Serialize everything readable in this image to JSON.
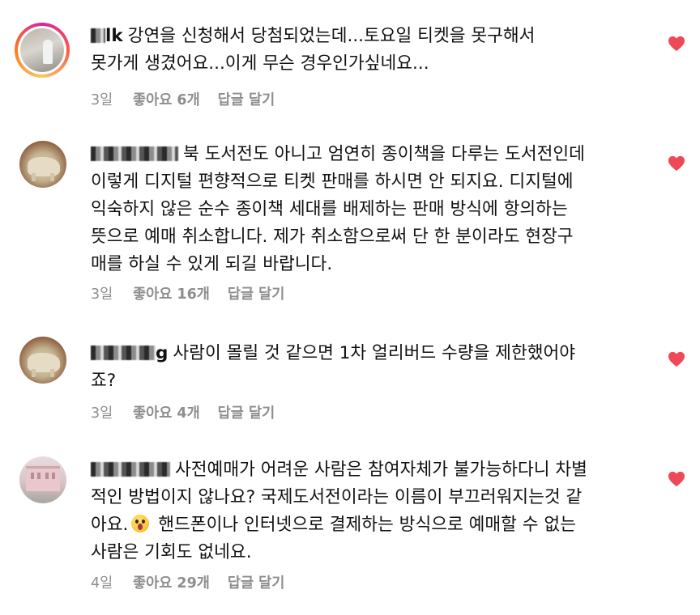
{
  "comments": [
    {
      "username": "lk",
      "text": "강연을 신청해서 당첨되었는데...토요일 티켓을 못구해서\n못가게 생겼어요...이게 무슨 경우인가싶네요...",
      "time": "3일",
      "likes": "좋아요 6개",
      "reply": "답글 달기",
      "avatar_icon": "profile-photo-story-ring",
      "liked": true
    },
    {
      "username": "",
      "text": "북 도서전도 아니고 엄연히 종이책을 다루는 도서전인데\n이렇게 디지털 편향적으로 티켓 판매를 하시면 안 되지요. 디지털에\n익숙하지 않은 순수 종이책 세대를 배제하는 판매 방식에 항의하는\n뜻으로 예매 취소합니다. 제가 취소함으로써 단 한 분이라도 현장구\n매를 하실 수 있게 되길 바랍니다.",
      "time": "3일",
      "likes": "좋아요 16개",
      "reply": "답글 달기",
      "avatar_icon": "elephant-figure",
      "liked": true
    },
    {
      "username": "g",
      "text": "사람이 몰릴 것 같으면 1차 얼리버드 수량을 제한했어야\n죠?",
      "time": "3일",
      "likes": "좋아요 4개",
      "reply": "답글 달기",
      "avatar_icon": "elephant-figure",
      "liked": true
    },
    {
      "username": "",
      "text_before_emoji": "사전예매가 어려운 사람은 참여자체가 불가능하다니 차별\n적인 방법이지 않나요? 국제도서전이라는 이름이 부끄러워지는것 같\n아요.",
      "emoji": "astonished-face",
      "text_after_emoji": " 핸드폰이나 인터넷으로 결제하는 방식으로 예매할 수 없는\n사람은 기회도 없네요.",
      "time": "4일",
      "likes": "좋아요 29개",
      "reply": "답글 달기",
      "avatar_icon": "pink-building",
      "liked": true
    }
  ],
  "colors": {
    "heart": "#ed4956",
    "meta_text": "#8e8e8e",
    "body_text": "#111111"
  }
}
